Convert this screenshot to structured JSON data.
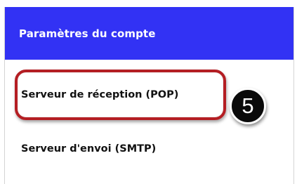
{
  "header": {
    "title": "Paramètres du compte",
    "background_color": "#3232f4"
  },
  "items": [
    {
      "label": "Serveur de réception (POP)",
      "highlighted": true
    },
    {
      "label": "Serveur d'envoi (SMTP)",
      "highlighted": false
    }
  ],
  "annotation": {
    "step_number": "5",
    "highlight_color": "#b41e23"
  }
}
